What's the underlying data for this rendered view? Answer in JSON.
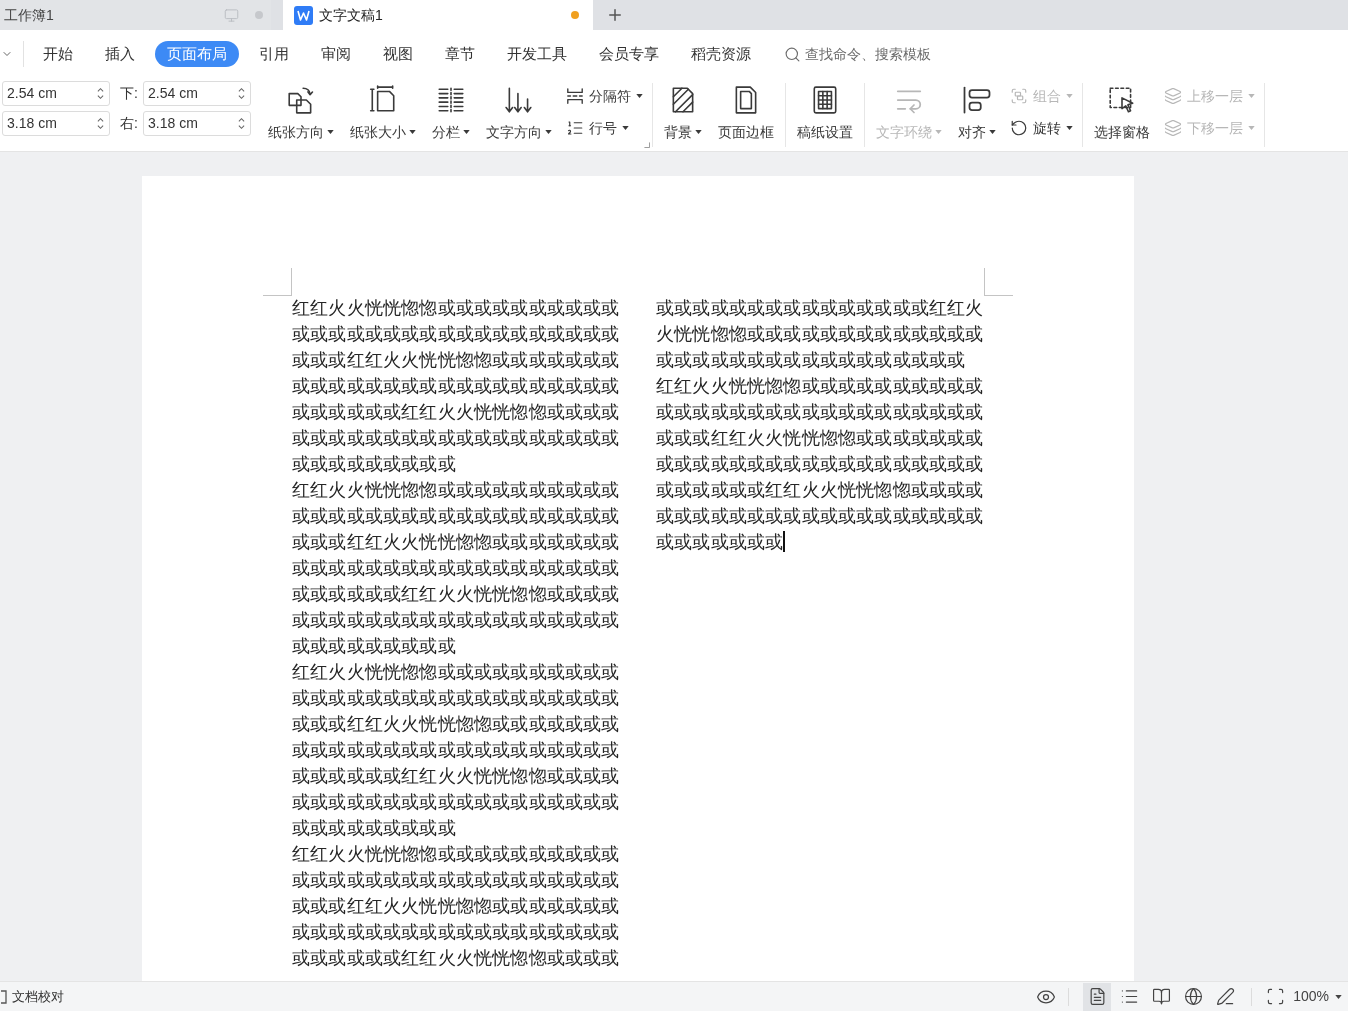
{
  "tabs": [
    {
      "label": "工作簿1",
      "selected": false,
      "modified": true,
      "app_icon": false
    },
    {
      "label": "文字文稿1",
      "selected": true,
      "modified": true,
      "app_icon": true
    }
  ],
  "menu": {
    "items": [
      {
        "label": "开始",
        "selected": false
      },
      {
        "label": "插入",
        "selected": false
      },
      {
        "label": "页面布局",
        "selected": true
      },
      {
        "label": "引用",
        "selected": false
      },
      {
        "label": "审阅",
        "selected": false
      },
      {
        "label": "视图",
        "selected": false
      },
      {
        "label": "章节",
        "selected": false
      },
      {
        "label": "开发工具",
        "selected": false
      },
      {
        "label": "会员专享",
        "selected": false
      },
      {
        "label": "稻壳资源",
        "selected": false
      }
    ],
    "search": {
      "placeholder": "查找命令、搜索模板"
    }
  },
  "margin_fields": [
    {
      "value": "2.54 cm"
    },
    {
      "label": "下:",
      "value": "2.54 cm"
    },
    {
      "value": "3.18 cm"
    },
    {
      "label": "右:",
      "value": "3.18 cm"
    }
  ],
  "toolbar_groups": [
    {
      "launcher": true,
      "items": [
        {
          "kind": "large",
          "label": "纸张方向",
          "dropdown": true,
          "disabled": false
        },
        {
          "kind": "large",
          "label": "纸张大小",
          "dropdown": true,
          "disabled": false
        },
        {
          "kind": "large",
          "label": "分栏",
          "dropdown": true,
          "disabled": false
        },
        {
          "kind": "large",
          "label": "文字方向",
          "dropdown": true,
          "disabled": false
        },
        {
          "kind": "small",
          "label": "分隔符",
          "dropdown": true,
          "disabled": false
        },
        {
          "kind": "small",
          "label": "行号",
          "dropdown": true,
          "disabled": false
        }
      ]
    },
    {
      "launcher": false,
      "items": [
        {
          "kind": "large",
          "label": "背景",
          "dropdown": true,
          "disabled": false
        },
        {
          "kind": "large",
          "label": "页面边框",
          "dropdown": false,
          "disabled": false
        }
      ]
    },
    {
      "launcher": false,
      "items": [
        {
          "kind": "large",
          "label": "稿纸设置",
          "dropdown": false,
          "disabled": false
        }
      ]
    },
    {
      "launcher": false,
      "items": [
        {
          "kind": "large",
          "label": "文字环绕",
          "dropdown": true,
          "disabled": true
        },
        {
          "kind": "large",
          "label": "对齐",
          "dropdown": true,
          "disabled": false
        },
        {
          "kind": "small",
          "label": "组合",
          "dropdown": true,
          "disabled": true
        },
        {
          "kind": "small",
          "label": "旋转",
          "dropdown": true,
          "disabled": false
        }
      ]
    },
    {
      "launcher": false,
      "items": [
        {
          "kind": "large",
          "label": "选择窗格",
          "dropdown": false,
          "disabled": false
        },
        {
          "kind": "small",
          "label": "上移一层",
          "dropdown": true,
          "disabled": true
        },
        {
          "kind": "small",
          "label": "下移一层",
          "dropdown": true,
          "disabled": true
        }
      ]
    }
  ],
  "document": {
    "columns": [
      {
        "paragraphs": [
          {
            "text": "红红火火恍恍惚惚或或或或或或或或或或或或或或或或或或或或或或或或或或或或或或或红红火火恍恍惚惚或或或或或或或或或或或或或或或或或或或或或或或或或或或或或或或红红火火恍恍惚惚或或或或或或或或或或或或或或或或或或或或或或或或或或或或或或或",
            "caret": false
          },
          {
            "text": "红红火火恍恍惚惚或或或或或或或或或或或或或或或或或或或或或或或或或或或或或或或红红火火恍恍惚惚或或或或或或或或或或或或或或或或或或或或或或或或或或或或或或或红红火火恍恍惚惚或或或或或或或或或或或或或或或或或或或或或或或或或或或或或或或",
            "caret": false
          },
          {
            "text": "红红火火恍恍惚惚或或或或或或或或或或或或或或或或或或或或或或或或或或或或或或或红红火火恍恍惚惚或或或或或或或或或或或或或或或或或或或或或或或或或或或或或或或红红火火恍恍惚惚或或或或或或或或或或或或或或或或或或或或或或或或或或或或或或或",
            "caret": false
          },
          {
            "text": "红红火火恍恍惚惚或或或或或或或或或或或或或或或或或或或或或或或或或或或或或或或红红火火恍恍惚惚或或或或或或或或或或或或或或或或或或或或或或或或或或或或或或或红红火火恍恍惚惚或或或或",
            "caret": false
          }
        ]
      },
      {
        "paragraphs": [
          {
            "text": "或或或或或或或或或或或或或或或红红火火恍恍惚惚或或或或或或或或或或或或或或或或或或或或或或或或或或或或或或",
            "caret": false
          },
          {
            "text": "红红火火恍恍惚惚或或或或或或或或或或或或或或或或或或或或或或或或或或或或或或或红红火火恍恍惚惚或或或或或或或或或或或或或或或或或或或或或或或或或或或或或或或红红火火恍恍惚惚或或或或或或或或或或或或或或或或或或或或或或或或或或或或或",
            "caret": true
          }
        ]
      }
    ]
  },
  "status_bar": {
    "proofread": "文档校对",
    "views": [
      {
        "selected": true
      },
      {
        "selected": false
      },
      {
        "selected": false
      },
      {
        "selected": false
      },
      {
        "selected": false
      }
    ],
    "zoom": "100%"
  }
}
